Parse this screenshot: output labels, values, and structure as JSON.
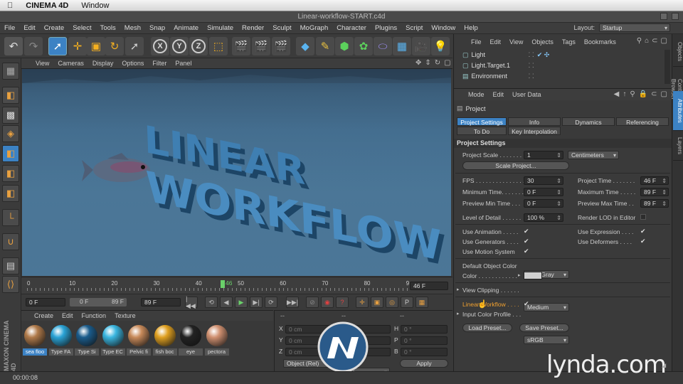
{
  "mac": {
    "apple": "",
    "app": "CINEMA 4D",
    "menu": "Window"
  },
  "window": {
    "title": "Linear-workflow-START.c4d"
  },
  "menubar": [
    "File",
    "Edit",
    "Create",
    "Select",
    "Tools",
    "Mesh",
    "Snap",
    "Animate",
    "Simulate",
    "Render",
    "Sculpt",
    "MoGraph",
    "Character",
    "Plugins",
    "Script",
    "Window",
    "Help"
  ],
  "layout": {
    "label": "Layout:",
    "value": "Startup"
  },
  "toolbar": {
    "x_label": "X",
    "y_label": "Y",
    "z_label": "Z"
  },
  "viewport": {
    "menu": [
      "View",
      "Cameras",
      "Display",
      "Options",
      "Filter",
      "Panel"
    ],
    "text_line1": "LINEAR",
    "text_line2": "WORKFLOW"
  },
  "timeline": {
    "ticks": [
      "0",
      "10",
      "20",
      "30",
      "40",
      "50",
      "60",
      "70",
      "80",
      "9"
    ],
    "current_frame_label": "46",
    "end_field": "46 F"
  },
  "playback": {
    "start": "0 F",
    "min": "0 F",
    "max": "89 F",
    "end": "89 F"
  },
  "materials": {
    "menu": [
      "Create",
      "Edit",
      "Function",
      "Texture"
    ],
    "items": [
      {
        "label": "sea floo",
        "color": "#b07a4a"
      },
      {
        "label": "Type FA",
        "color": "#2aa3d6"
      },
      {
        "label": "Type Si",
        "color": "#1a5c8c"
      },
      {
        "label": "Type EC",
        "color": "#3ab6e0"
      },
      {
        "label": "Pelvic fi",
        "color": "#c88a5a"
      },
      {
        "label": "fish boc",
        "color": "#e0a020"
      },
      {
        "label": "eye",
        "color": "#222222"
      },
      {
        "label": "pectora",
        "color": "#d09070"
      }
    ]
  },
  "coords": {
    "header": "--",
    "rows": [
      {
        "a": "X",
        "av": "0 cm",
        "b": "X",
        "bv": "0 cm",
        "c": "H",
        "cv": "0 °"
      },
      {
        "a": "Y",
        "av": "0 cm",
        "b": "Y",
        "bv": "0 cm",
        "c": "P",
        "cv": "0 °"
      },
      {
        "a": "Z",
        "av": "0 cm",
        "b": "Z",
        "bv": "0 cm",
        "c": "B",
        "cv": "0 °"
      }
    ],
    "mode": "Object (Rel)",
    "size_mode": "Size",
    "apply": "Apply"
  },
  "status": {
    "time": "00:00:08"
  },
  "objects": {
    "menu": [
      "File",
      "Edit",
      "View",
      "Objects",
      "Tags",
      "Bookmarks"
    ],
    "rows": [
      "Light",
      "Light.Target.1",
      "Environment"
    ]
  },
  "attributes": {
    "menu": [
      "Mode",
      "Edit",
      "User Data"
    ],
    "title": "Project",
    "tabs": [
      "Project Settings",
      "Info",
      "Dynamics",
      "Referencing",
      "To Do",
      "Key Interpolation"
    ],
    "section": "Project Settings",
    "project_scale_label": "Project Scale . . . . . . .",
    "project_scale_value": "1",
    "project_scale_unit": "Centimeters",
    "scale_project_button": "Scale Project...",
    "fps_label": "FPS . . . . . . . . . . . . . . .",
    "fps_value": "30",
    "project_time_label": "Project Time . . . . . . .",
    "project_time_value": "46 F",
    "min_time_label": "Minimum Time. . . . . . .",
    "min_time_value": "0 F",
    "max_time_label": "Maximum Time . . . . .",
    "max_time_value": "89 F",
    "preview_min_label": "Preview Min Time . . .",
    "preview_min_value": "0 F",
    "preview_max_label": "Preview Max Time . .",
    "preview_max_value": "89 F",
    "lod_label": "Level of Detail . . . . . .",
    "lod_value": "100 %",
    "render_lod_label": "Render LOD in Editor",
    "use_animation_label": "Use Animation . . . . .",
    "use_expression_label": "Use Expression . . . .",
    "use_generators_label": "Use Generators . . . .",
    "use_deformers_label": "Use Deformers . . . .",
    "use_motion_label": "Use Motion System",
    "default_color_label": "Default Object Color",
    "default_color_value": "80% Gray",
    "color_label": "Color . . . . . . . . . . . .",
    "view_clipping_label": "View Clipping . . . . . .",
    "view_clipping_value": "Medium",
    "linear_workflow_label": "Linear Workflow . . . .",
    "input_profile_label": "Input Color Profile . . .",
    "input_profile_value": "sRGB",
    "load_preset": "Load Preset...",
    "save_preset": "Save Preset..."
  },
  "right_tabs": [
    "Objects",
    "Content Browser",
    "Attributes",
    "Layers"
  ],
  "watermark": "lynda.com",
  "brand_side": "MAXON CINEMA 4D"
}
